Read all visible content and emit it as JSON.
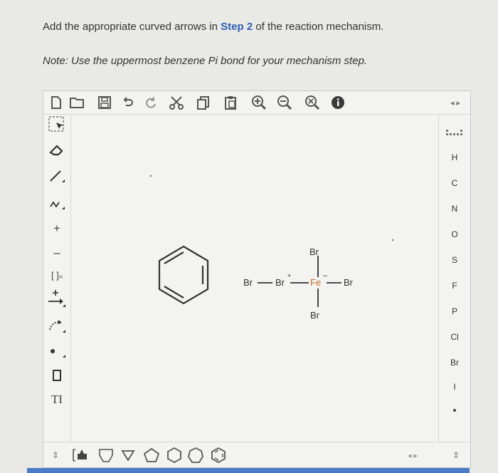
{
  "question": {
    "part1": "Add the appropriate curved arrows in ",
    "step": "Step 2",
    "part2": " of the reaction mechanism.",
    "note": "Note: Use the uppermost benzene Pi bond for your mechanism step."
  },
  "toolbar": {
    "icons": [
      "new-document-icon",
      "open-folder-icon",
      "save-icon",
      "undo-icon",
      "redo-icon",
      "cut-icon",
      "copy-icon",
      "paste-icon",
      "zoom-in-icon",
      "zoom-out-icon",
      "zoom-fit-icon",
      "info-icon"
    ]
  },
  "left_tools": {
    "charge_plus": "+",
    "charge_minus": "–",
    "bracket": "[ ]ₙ",
    "arrow_tool": "+",
    "text_tool": "TI"
  },
  "elements": [
    "H",
    "C",
    "N",
    "O",
    "S",
    "F",
    "P",
    "Cl",
    "Br",
    "I"
  ],
  "molecule": {
    "br_top": "Br",
    "br_left": "Br",
    "br_plus": "Br",
    "plus": "+",
    "fe": "Fe",
    "minus": "–",
    "br_right": "Br",
    "br_bottom": "Br"
  },
  "colors": {
    "accent": "#2f5fb3",
    "bottom_strip": "#4a7bc8",
    "fe": "#c86a2a"
  }
}
